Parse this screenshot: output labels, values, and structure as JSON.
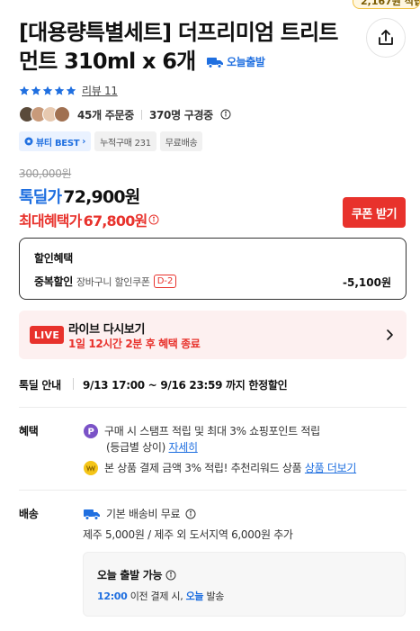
{
  "point_badge": "2,167원 적립",
  "product": {
    "title": "[대용량특별세트] 더프리미엄 트리트먼트 310ml x 6개",
    "today_tag": "오늘출발"
  },
  "rating": {
    "stars": 5,
    "review_link": "리뷰 11"
  },
  "orders": {
    "order_count": "45개 주문중",
    "buyers": "370명 구경중"
  },
  "chips": [
    {
      "label": "뷰티 BEST"
    },
    {
      "label": "누적구매 231"
    },
    {
      "label": "무료배송"
    }
  ],
  "price": {
    "original": "300,000원",
    "deal_label": "톡딜가",
    "deal_price": "72,900원",
    "max_label": "최대혜택가",
    "max_price": "67,800원",
    "coupon_button": "쿠폰 받기"
  },
  "discount": {
    "title": "할인혜택",
    "row_bold": "중복할인",
    "row_sub": "장바구니 할인쿠폰",
    "dday": "D-2",
    "amount": "-5,100원"
  },
  "live": {
    "badge": "LIVE",
    "title": "라이브 다시보기",
    "sub": "1일 12시간 2분 후 혜택 종료"
  },
  "deal_info": {
    "label": "톡딜 안내",
    "value": "9/13 17:00 ~ 9/16 23:59 까지 한정할인"
  },
  "benefit": {
    "label": "혜택",
    "line1": "구매 시 스탬프 적립 및 최대 3% 쇼핑포인트 적립",
    "line1b": "(등급별 상이) ",
    "line1_link": "자세히",
    "line2": "본 상품 결제 금액 3% 적립! 추천리워드 상품 ",
    "line2_link": "상품 더보기"
  },
  "shipping": {
    "label": "배송",
    "line1": "기본 배송비 무료",
    "line2": "제주 5,000원 / 제주 외 도서지역 6,000원 추가",
    "box_title": "오늘 출발 가능",
    "box_time": "12:00",
    "box_mid": " 이전 결제 시, ",
    "box_today": "오늘",
    "box_end": " 발송"
  },
  "colors": {
    "accent_blue": "#1f6fe0",
    "accent_red": "#e8322c"
  }
}
